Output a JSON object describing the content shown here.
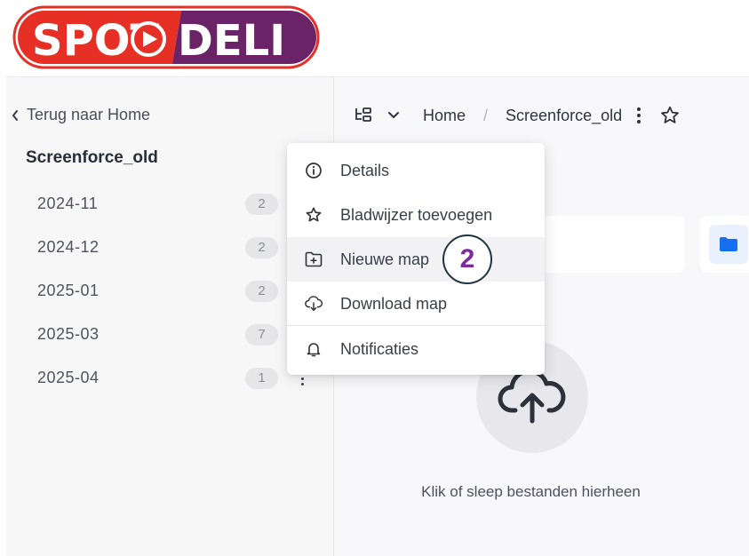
{
  "logo": {
    "text_left": "SPOT",
    "text_right": "DELI"
  },
  "sidebar": {
    "back_label": "Terug naar Home",
    "current_folder": "Screenforce_old",
    "items": [
      {
        "label": "2024-11",
        "count": "2"
      },
      {
        "label": "2024-12",
        "count": "2"
      },
      {
        "label": "2025-01",
        "count": "2"
      },
      {
        "label": "2025-03",
        "count": "7"
      },
      {
        "label": "2025-04",
        "count": "1"
      }
    ]
  },
  "breadcrumb": {
    "home": "Home",
    "separator": "/",
    "current": "Screenforce_old"
  },
  "context_menu": {
    "items": [
      {
        "label": "Details",
        "icon": "info-icon"
      },
      {
        "label": "Bladwijzer toevoegen",
        "icon": "star-icon"
      },
      {
        "label": "Nieuwe map",
        "icon": "new-folder-icon"
      },
      {
        "label": "Download map",
        "icon": "cloud-download-icon"
      },
      {
        "label": "Notificaties",
        "icon": "bell-icon"
      }
    ]
  },
  "upload": {
    "text": "Klik of sleep bestanden hierheen"
  },
  "step_badge": "2",
  "colors": {
    "logo_red": "#e63026",
    "logo_purple": "#6b2368",
    "accent_blue": "#1570ef",
    "badge_number": "#7a2ca0"
  }
}
